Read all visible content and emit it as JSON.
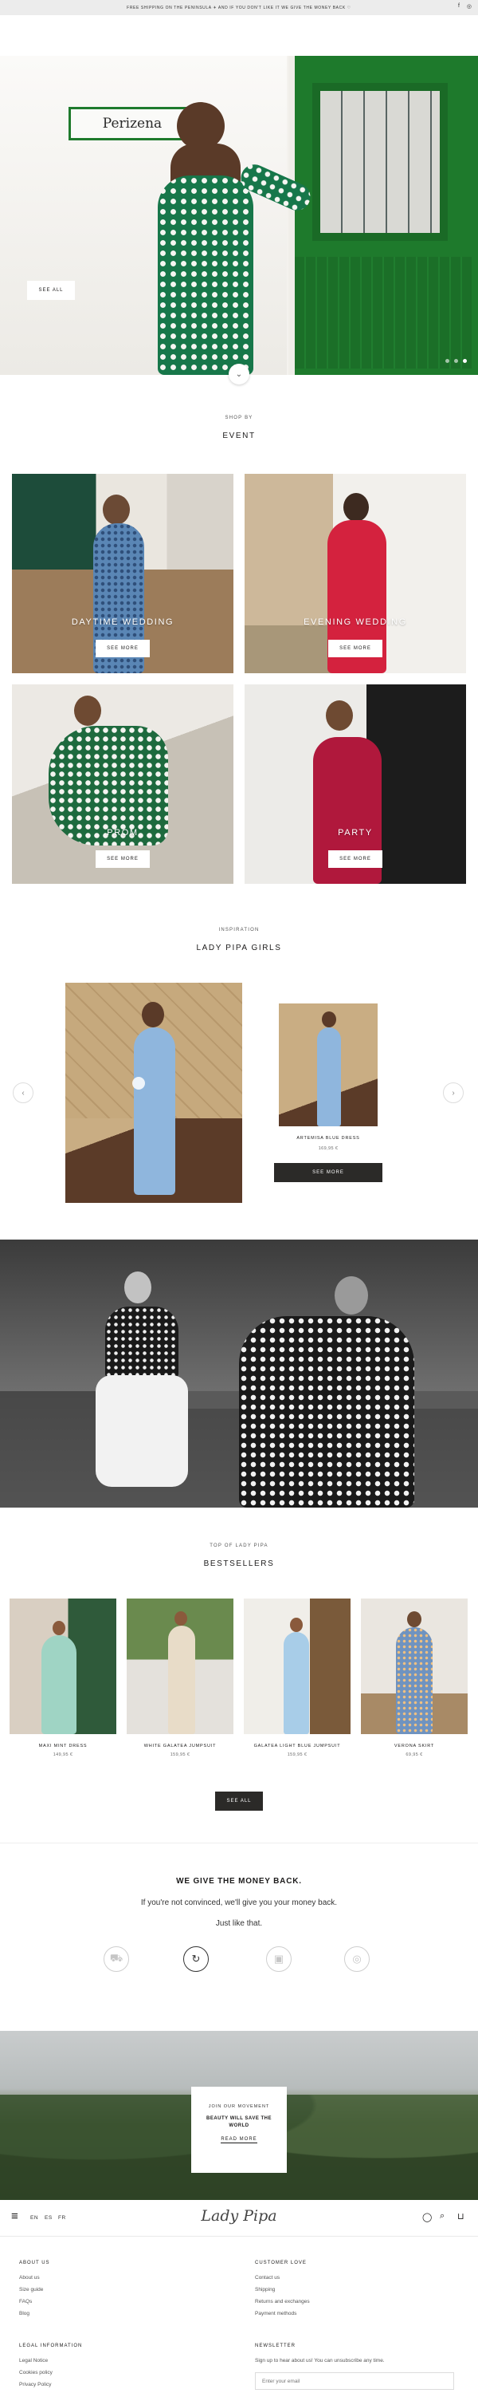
{
  "announcement": {
    "text": "FREE SHIPPING ON THE PENINSULA ✈ AND IF YOU DON'T LIKE IT WE GIVE THE MONEY BACK ♡",
    "social_icons": [
      "facebook-icon",
      "instagram-icon"
    ],
    "social_glyphs": [
      "f",
      "◎"
    ]
  },
  "hero": {
    "sign_text": "Perizena",
    "see_all": "SEE ALL",
    "slides": 3,
    "active_slide": 3
  },
  "event": {
    "eyebrow": "SHOP BY",
    "title": "EVENT",
    "tiles": [
      {
        "label": "DAYTIME WEDDING",
        "button": "SEE MORE"
      },
      {
        "label": "EVENING WEDDING",
        "button": "SEE MORE"
      },
      {
        "label": "PROM",
        "button": "SEE MORE"
      },
      {
        "label": "PARTY",
        "button": "SEE MORE"
      }
    ]
  },
  "inspiration": {
    "eyebrow": "INSPIRATION",
    "title": "LADY PIPA GIRLS",
    "product": {
      "name": "ARTEMISA BLUE DRESS",
      "price": "169,95 €",
      "button": "SEE MORE"
    },
    "prev_glyph": "‹",
    "next_glyph": "›"
  },
  "bestsellers": {
    "eyebrow": "TOP OF LADY PIPA",
    "title": "BESTSELLERS",
    "products": [
      {
        "name": "MAXI MINT DRESS",
        "price": "149,95 €"
      },
      {
        "name": "WHITE GALATEA JUMPSUIT",
        "price": "159,95 €"
      },
      {
        "name": "GALATEA LIGHT BLUE JUMPSUIT",
        "price": "159,95 €"
      },
      {
        "name": "VERONA SKIRT",
        "price": "69,95 €"
      }
    ],
    "see_all": "SEE ALL"
  },
  "money_back": {
    "title": "WE GIVE THE MONEY BACK.",
    "line1": "If you're not convinced, we'll give you your money back.",
    "line2": "Just like that.",
    "icons": [
      "delivery-truck-icon",
      "refresh-icon",
      "secure-payment-icon",
      "support-icon"
    ],
    "icon_glyphs": [
      "⛟",
      "↻",
      "▣",
      "◎"
    ]
  },
  "newsletter_banner": {
    "eyebrow": "JOIN OUR MOVEMENT",
    "title": "BEAUTY WILL SAVE THE WORLD",
    "link": "READ MORE"
  },
  "bottom_header": {
    "languages": [
      "EN",
      "ES",
      "FR"
    ],
    "logo": "Lady Pipa",
    "menu_glyph": "≡",
    "icon_glyphs": [
      "◯",
      "⌕",
      "⊔"
    ]
  },
  "footer": {
    "about": {
      "title": "ABOUT US",
      "links": [
        "About us",
        "Size guide",
        "FAQs",
        "Blog"
      ]
    },
    "customer": {
      "title": "CUSTOMER LOVE",
      "links": [
        "Contact us",
        "Shipping",
        "Returns and exchanges",
        "Payment methods"
      ]
    },
    "legal": {
      "title": "LEGAL INFORMATION",
      "links": [
        "Legal Notice",
        "Cookies policy",
        "Privacy Policy"
      ]
    },
    "newsletter": {
      "title": "NEWSLETTER",
      "text": "Sign up to hear about us! You can unsubscribe any time.",
      "placeholder": "Enter your email"
    }
  },
  "colors": {
    "accent_dark": "#2b2a28",
    "announcement_bg": "#ececec",
    "hero_green": "#1e7a2c"
  }
}
